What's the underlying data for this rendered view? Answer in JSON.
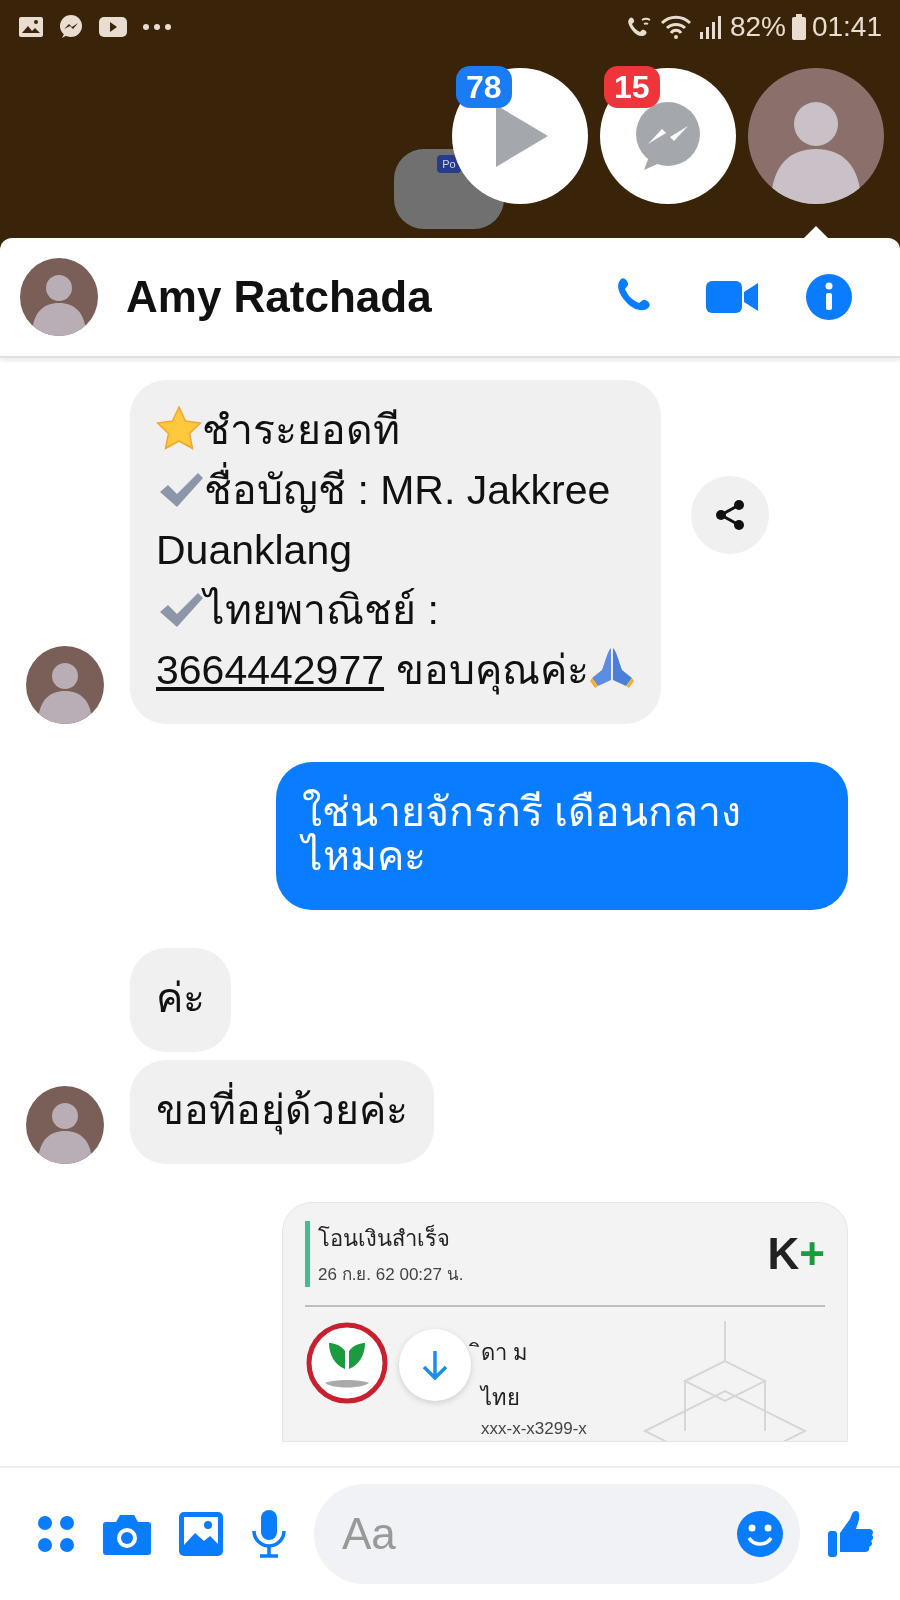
{
  "status_bar": {
    "battery": "82%",
    "time": "01:41"
  },
  "chat_heads": [
    {
      "kind": "video",
      "badge": "78"
    },
    {
      "kind": "messenger",
      "badge": "15"
    },
    {
      "kind": "avatar"
    }
  ],
  "folder": {
    "label": "Po"
  },
  "header": {
    "name": "Amy Ratchada"
  },
  "messages": [
    {
      "kind": "text",
      "outgoing": false,
      "avatar": true,
      "share": true,
      "lines": [
        {
          "kind": "star",
          "text": "ชำระยอดที"
        },
        {
          "kind": "check",
          "text": "ชื่อบัญชี : MR. Jakkree"
        },
        {
          "kind": "plain",
          "text": "Duanklang"
        },
        {
          "kind": "check",
          "text": "ไทยพาณิชย์ :"
        },
        {
          "kind": "link",
          "link": "3664442977",
          "text": "ขอบคุณค่ะ",
          "pray": true
        }
      ]
    },
    {
      "kind": "text",
      "outgoing": true,
      "avatar": false,
      "share": false,
      "lines": [
        {
          "kind": "plain",
          "text": "ใช่นายจักรกรี เดือนกลาง ไหมคะ"
        }
      ]
    },
    {
      "kind": "text",
      "outgoing": false,
      "avatar": false,
      "share": false,
      "lines": [
        {
          "kind": "plain",
          "text": "ค่ะ"
        }
      ]
    },
    {
      "kind": "text",
      "outgoing": false,
      "avatar": true,
      "share": false,
      "lines": [
        {
          "kind": "plain",
          "text": "ขอที่อยุ่ด้วยค่ะ"
        }
      ]
    },
    {
      "kind": "receipt",
      "outgoing": true,
      "avatar": false,
      "share": false,
      "title": "โอนเงินสำเร็จ",
      "date": "26 ก.ย. 62  00:27 น.",
      "brand": "K",
      "brand_plus": "+",
      "name_part": "ิดา ม",
      "bank_part": "ไทย",
      "account": "xxx-x-x3299-x"
    }
  ],
  "composer": {
    "placeholder": "Aa"
  }
}
